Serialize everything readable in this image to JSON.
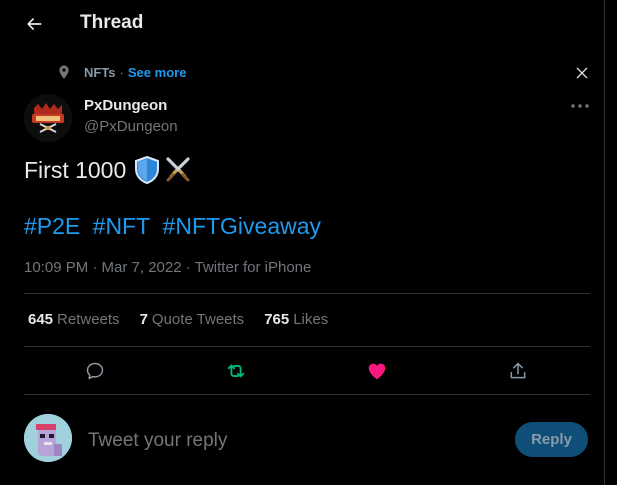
{
  "header": {
    "title": "Thread",
    "back_icon": "arrow-left-icon"
  },
  "context": {
    "topic_icon": "topic-pin-icon",
    "label": "NFTs",
    "separator": "·",
    "see_more": "See more",
    "close_icon": "close-icon"
  },
  "author": {
    "name": "PxDungeon",
    "handle": "@PxDungeon",
    "more_icon": "more-horizontal-icon"
  },
  "tweet": {
    "text": "First 1000",
    "emojis": [
      "shield-emoji",
      "crossed-swords-emoji"
    ],
    "hashtags": [
      "#P2E",
      "#NFT",
      "#NFTGiveaway"
    ],
    "meta": "10:09 PM · Mar 7, 2022 · Twitter for iPhone"
  },
  "stats": [
    {
      "count": "645",
      "label": "Retweets"
    },
    {
      "count": "7",
      "label": "Quote Tweets"
    },
    {
      "count": "765",
      "label": "Likes"
    }
  ],
  "actions": {
    "reply_icon": "reply-icon",
    "retweet_icon": "retweet-icon",
    "like_icon": "heart-icon",
    "share_icon": "share-icon"
  },
  "reply": {
    "placeholder": "Tweet your reply",
    "button_label": "Reply"
  },
  "colors": {
    "background": "#000000",
    "accent": "#1d9bf0",
    "retweet_active": "#00ba7c",
    "like_active": "#f91880",
    "muted": "#71767b",
    "border": "#2f3336"
  }
}
